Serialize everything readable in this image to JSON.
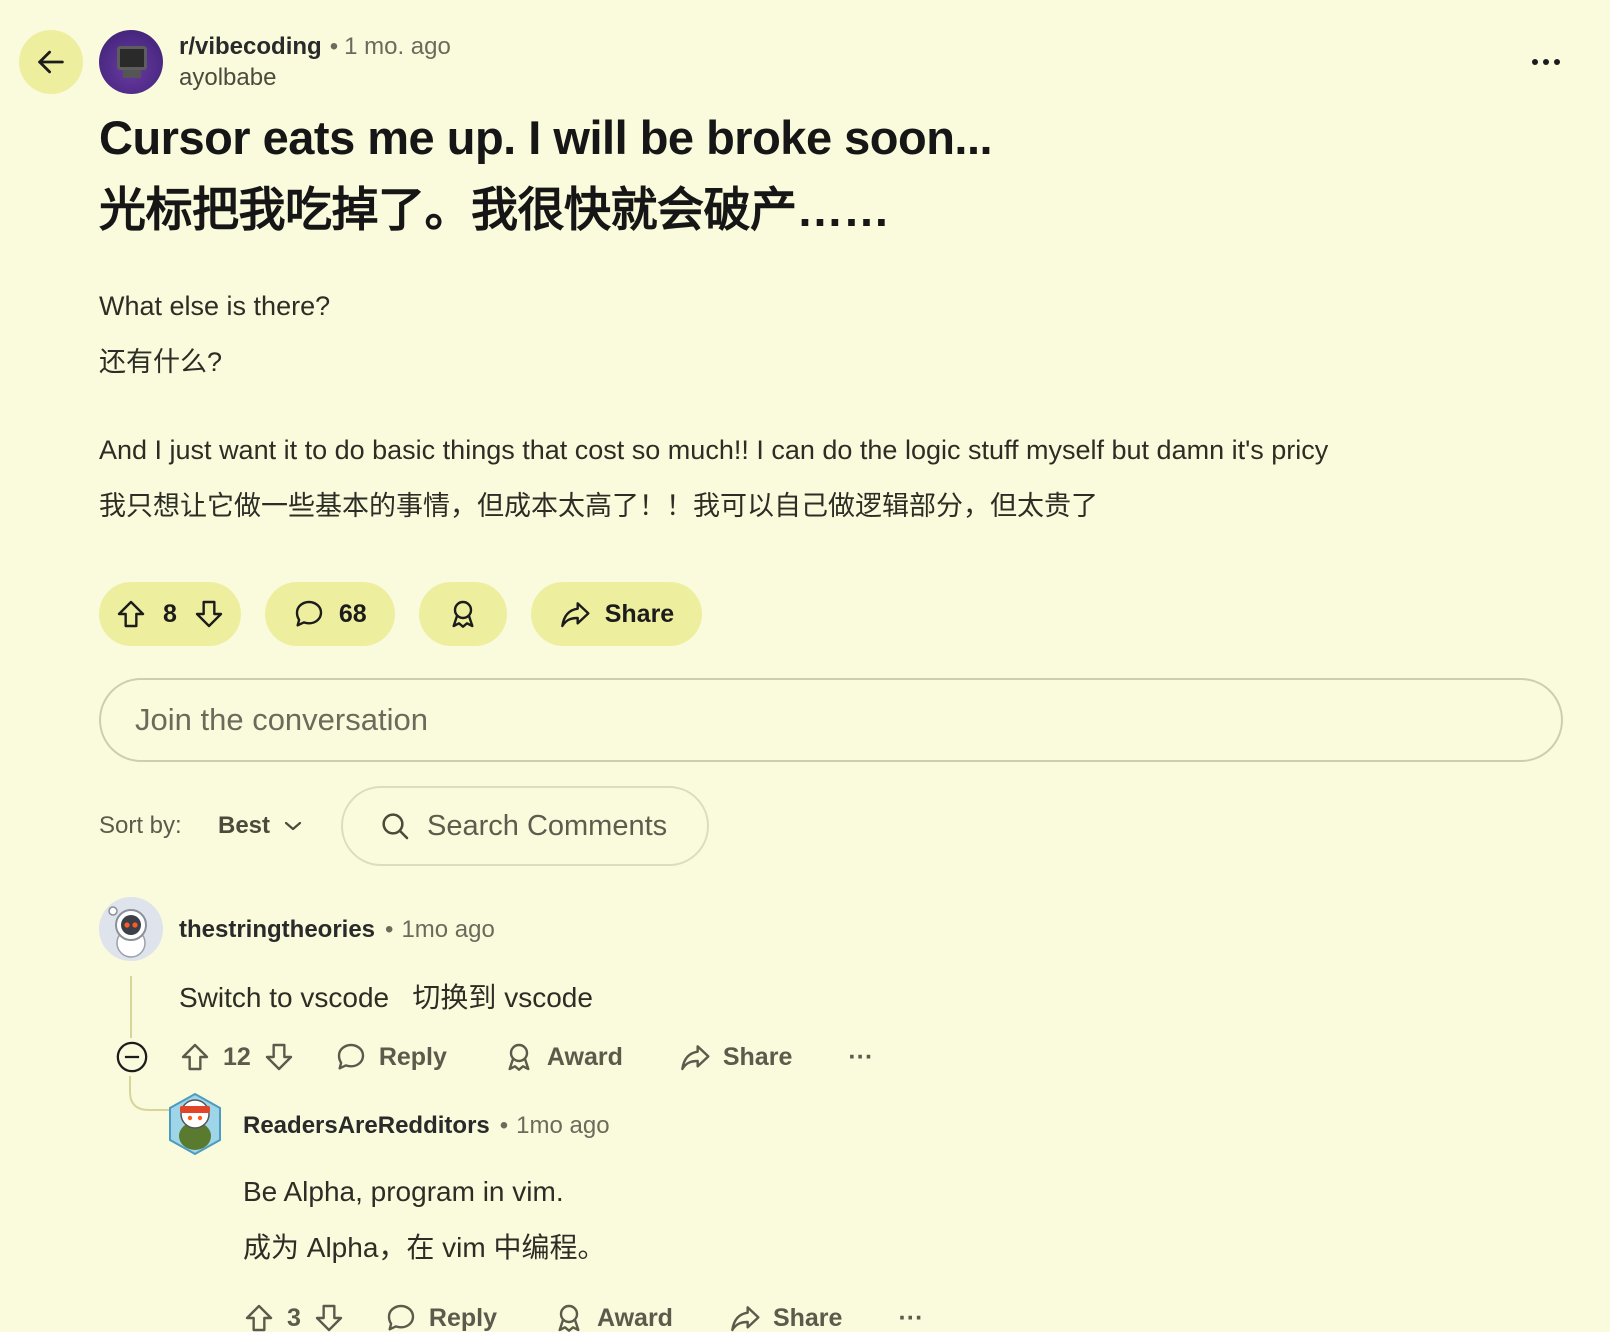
{
  "post": {
    "subreddit": "r/vibecoding",
    "separator": "•",
    "time": "1 mo. ago",
    "author": "ayolbabe",
    "title_en": "Cursor eats me up. I will be broke soon...",
    "title_zh": "光标把我吃掉了。我很快就会破产……",
    "body": [
      "What else is there?",
      "还有什么?",
      "And I just want it to do basic things that cost so much!! I can do the logic stuff myself but damn it's pricy",
      "我只想让它做一些基本的事情，但成本太高了！！我可以自己做逻辑部分，但太贵了"
    ],
    "votes": "8",
    "comments": "68",
    "share_label": "Share"
  },
  "composer": {
    "placeholder": "Join the conversation"
  },
  "sort": {
    "label": "Sort by:",
    "value": "Best"
  },
  "search": {
    "placeholder": "Search Comments"
  },
  "comments": [
    {
      "user": "thestringtheories",
      "separator": "•",
      "time": "1mo ago",
      "text": "Switch to vscode   切换到 vscode",
      "votes": "12",
      "reply": "Reply",
      "award": "Award",
      "share": "Share",
      "more": "···"
    },
    {
      "user": "ReadersAreRedditors",
      "separator": "•",
      "time": "1mo ago",
      "text_en": "Be Alpha, program in vim.",
      "text_zh": "成为 Alpha，在 vim 中编程。",
      "votes": "3",
      "reply": "Reply",
      "award": "Award",
      "share": "Share",
      "more": "···"
    }
  ],
  "icons": {
    "back": "arrow-left-icon",
    "more": "ellipsis-icon",
    "upvote": "upvote-arrow-icon",
    "downvote": "downvote-arrow-icon",
    "comment": "speech-bubble-icon",
    "award": "award-ribbon-icon",
    "share": "share-arrow-icon",
    "search": "search-icon",
    "chevron": "chevron-down-icon",
    "collapse": "collapse-minus-icon"
  },
  "colors": {
    "background": "#fafadc",
    "pill": "#eeef9e",
    "thread_line": "#d8d59a"
  }
}
